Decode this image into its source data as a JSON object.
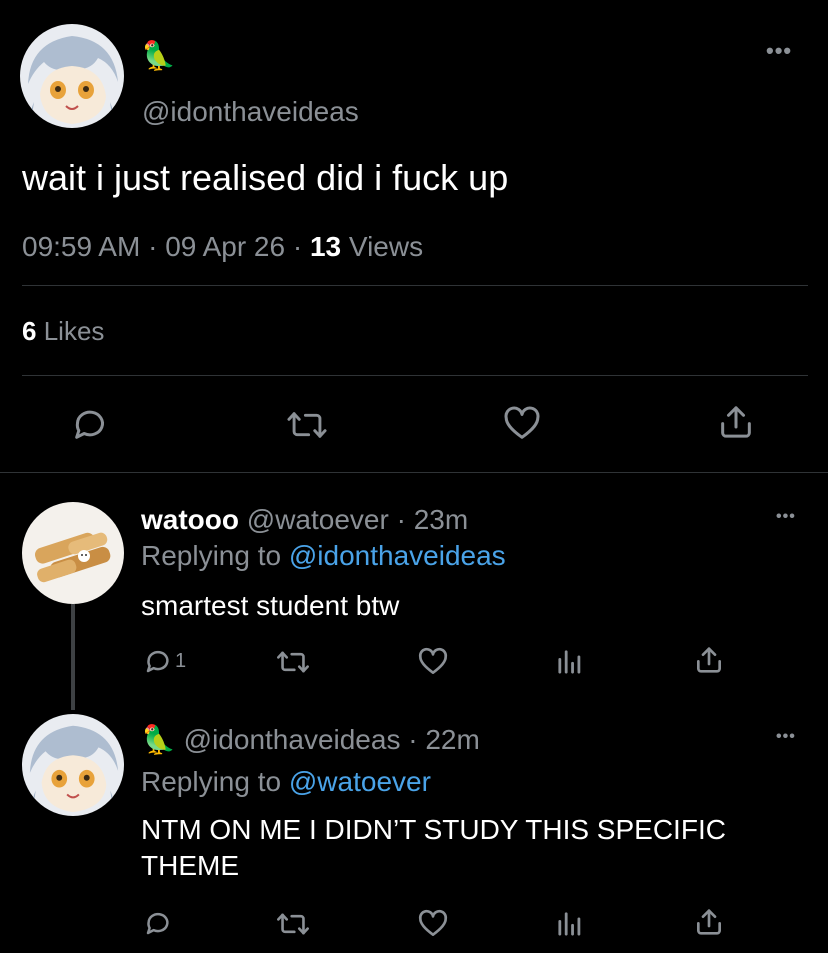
{
  "main": {
    "display_name": "🦜",
    "handle": "@idonthaveideas",
    "text": "wait i just realised did i fuck up",
    "time": "09:59 AM",
    "date": "09 Apr 26",
    "sep": "·",
    "views_count": "13",
    "views_label": "Views",
    "likes_count": "6",
    "likes_label": "Likes",
    "more": "•••"
  },
  "replies": [
    {
      "name": "watooo",
      "handle": "@watoever",
      "time": "23m",
      "sep": "·",
      "replying_label": "Replying to",
      "replying_to": "@idonthaveideas",
      "text": "smartest student btw",
      "reply_count": "1",
      "more": "•••"
    },
    {
      "name": "🦜",
      "handle": "@idonthaveideas",
      "time": "22m",
      "sep": "·",
      "replying_label": "Replying to",
      "replying_to": "@watoever",
      "text": "NTM ON ME I DIDN’T STUDY THIS SPECIFIC THEME",
      "reply_count": "",
      "more": "•••"
    }
  ],
  "icons": [
    "comment-icon",
    "retweet-icon",
    "heart-icon",
    "share-icon",
    "analytics-icon"
  ],
  "colors": {
    "background": "#000000",
    "text": "#e7e9ea",
    "muted": "#8b9096",
    "link": "#4aa3e8",
    "divider": "#2f3336"
  }
}
